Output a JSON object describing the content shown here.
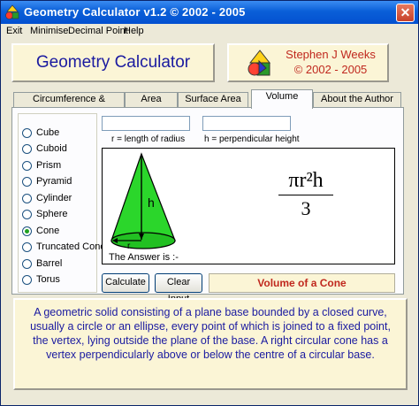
{
  "window": {
    "title": "Geometry Calculator v1.2 © 2002 - 2005",
    "close_glyph": "✕"
  },
  "menu": {
    "items": [
      "Exit",
      "Minimise",
      "Decimal Point",
      "Help"
    ]
  },
  "header": {
    "app_title": "Geometry Calculator",
    "author_name": "Stephen J Weeks",
    "author_years": "© 2002 - 2005"
  },
  "tabs": [
    {
      "label": "Circumference & Diameter",
      "active": false
    },
    {
      "label": "Area",
      "active": false
    },
    {
      "label": "Surface Area",
      "active": false
    },
    {
      "label": "Volume",
      "active": true
    },
    {
      "label": "About the Author",
      "active": false
    }
  ],
  "shapes": [
    {
      "label": "Cube",
      "checked": false
    },
    {
      "label": "Cuboid",
      "checked": false
    },
    {
      "label": "Prism",
      "checked": false
    },
    {
      "label": "Pyramid",
      "checked": false
    },
    {
      "label": "Cylinder",
      "checked": false
    },
    {
      "label": "Sphere",
      "checked": false
    },
    {
      "label": "Cone",
      "checked": true
    },
    {
      "label": "Truncated Cone",
      "checked": false
    },
    {
      "label": "Barrel",
      "checked": false
    },
    {
      "label": "Torus",
      "checked": false
    }
  ],
  "inputs": {
    "radius": {
      "value": "",
      "caption": "r = length of radius"
    },
    "height": {
      "value": "",
      "caption": "h = perpendicular height"
    }
  },
  "diagram": {
    "height_label": "h",
    "radius_label": "r",
    "answer_label": "The Answer is :-"
  },
  "formula": {
    "numerator": "πr²h",
    "denominator": "3"
  },
  "buttons": {
    "calculate": "Calculate",
    "clear_input": "Clear Input"
  },
  "result_title": "Volume of a Cone",
  "description": "A geometric solid consisting of a plane base bounded by a closed curve, usually a circle or an ellipse, every point of which is joined to a fixed point, the vertex, lying outside the plane of the base. A right circular cone has a vertex perpendicularly above or below the centre of a circular base.",
  "colors": {
    "titlebar": "#0a5fd8",
    "panel_bg": "#fbf5d6",
    "title_blue": "#1a1aa0",
    "accent_red": "#c0281e",
    "cone_green": "#2bd62b"
  },
  "icons": {
    "app": "shapes-icon",
    "close": "close-icon",
    "logo": "shapes-logo-icon"
  }
}
